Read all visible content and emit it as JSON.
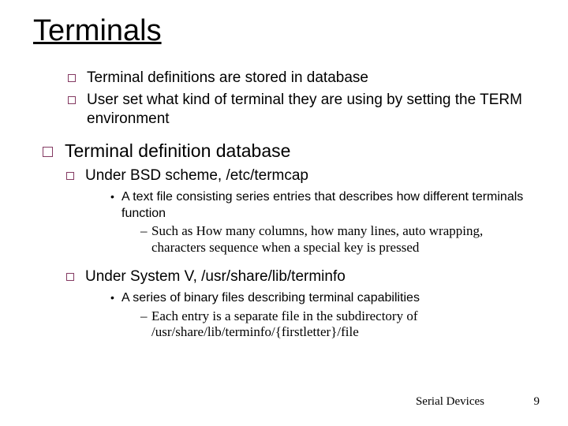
{
  "title": "Terminals",
  "intro": [
    "Terminal definitions are stored in database",
    "User set what kind of terminal they are using by setting the TERM environment"
  ],
  "section": {
    "heading": "Terminal definition database",
    "items": [
      {
        "label": "Under BSD scheme, /etc/termcap",
        "sub": {
          "text": "A text file consisting series entries that describes how different terminals function",
          "detail": "Such as How many columns, how many lines, auto wrapping, characters sequence when a special key is pressed"
        }
      },
      {
        "label": "Under System V, /usr/share/lib/terminfo",
        "sub": {
          "text": "A series of binary files describing terminal capabilities",
          "detail": "Each entry is a separate file in the subdirectory of /usr/share/lib/terminfo/{firstletter}/file"
        }
      }
    ]
  },
  "footer": {
    "label": "Serial Devices",
    "page": "9"
  }
}
